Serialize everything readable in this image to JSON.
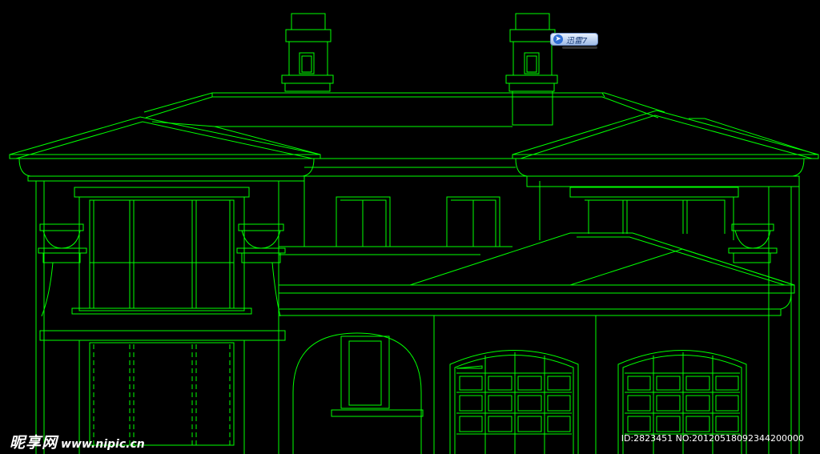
{
  "drawing": {
    "line_color": "#00ff00",
    "background": "#000000"
  },
  "badge": {
    "label": "迅雷7",
    "icon": "thunder-bird-icon"
  },
  "watermark": {
    "logo": "昵享网",
    "url": "www.nipic.cn",
    "id_text": "ID:2823451 NO:20120518092344200000"
  }
}
